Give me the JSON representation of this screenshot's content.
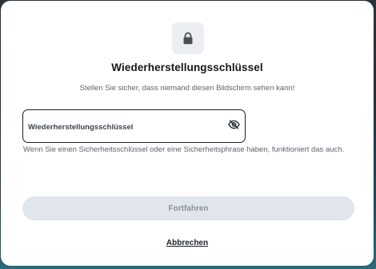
{
  "dialog": {
    "icon": "lock-icon",
    "title": "Wiederherstellungsschlüssel",
    "subtitle": "Stellen Sie sicher, dass niemand diesen Bildschirm sehen kann!",
    "field": {
      "label": "Wiederherstellungsschlüssel",
      "value": "",
      "toggle_icon": "eye-off-icon"
    },
    "hint": "Wenn Sie einen Sicherheitsschlüssel oder eine Sicherheitsphrase haben, funktioniert das auch.",
    "continue_label": "Fortfahren",
    "continue_enabled": false,
    "cancel_label": "Abbrechen"
  },
  "colors": {
    "accent_border": "#1b1d21",
    "disabled_button_bg": "#e1e5ec",
    "disabled_button_text": "#8a919c",
    "muted_text": "#5c6470"
  }
}
